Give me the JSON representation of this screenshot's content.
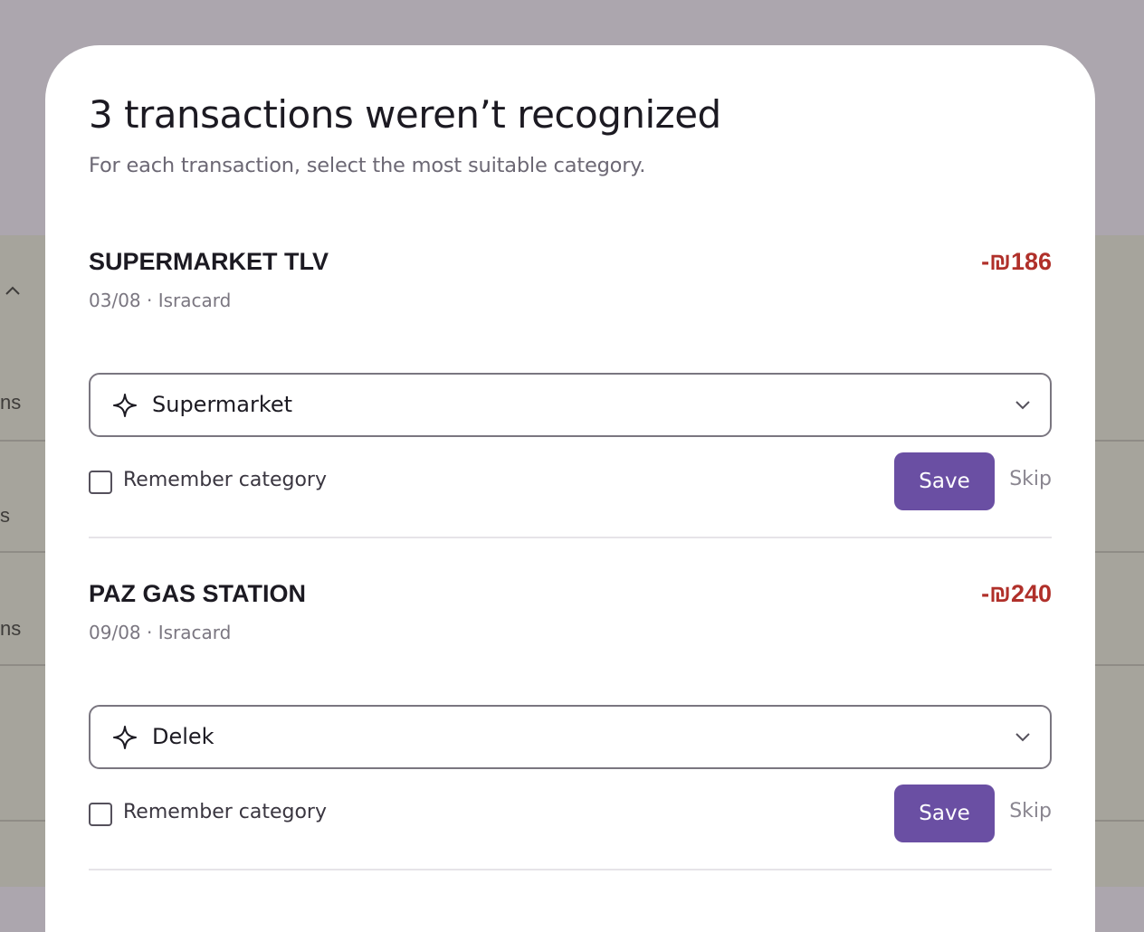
{
  "background": {
    "row_fragments": [
      "ns",
      "s",
      "ns"
    ]
  },
  "modal": {
    "title": "3 transactions weren’t recognized",
    "subtitle": "For each transaction, select the most suitable category."
  },
  "transactions": [
    {
      "merchant": "SUPERMARKET TLV",
      "amount": "-₪186",
      "meta": "03/08 · Isracard",
      "category": "Supermarket",
      "remember_label": "Remember category",
      "remember_checked": false,
      "save_label": "Save",
      "skip_label": "Skip"
    },
    {
      "merchant": "PAZ GAS STATION",
      "amount": "-₪240",
      "meta": "09/08 · Isracard",
      "category": "Delek",
      "remember_label": "Remember category",
      "remember_checked": false,
      "save_label": "Save",
      "skip_label": "Skip"
    }
  ],
  "colors": {
    "accent": "#6a4fa3",
    "negative_amount": "#b0302a",
    "overlay": "#aca6ae"
  },
  "icons": {
    "category": "sparkle-icon",
    "dropdown": "chevron-down-icon",
    "background_toggle": "chevron-up-icon"
  }
}
